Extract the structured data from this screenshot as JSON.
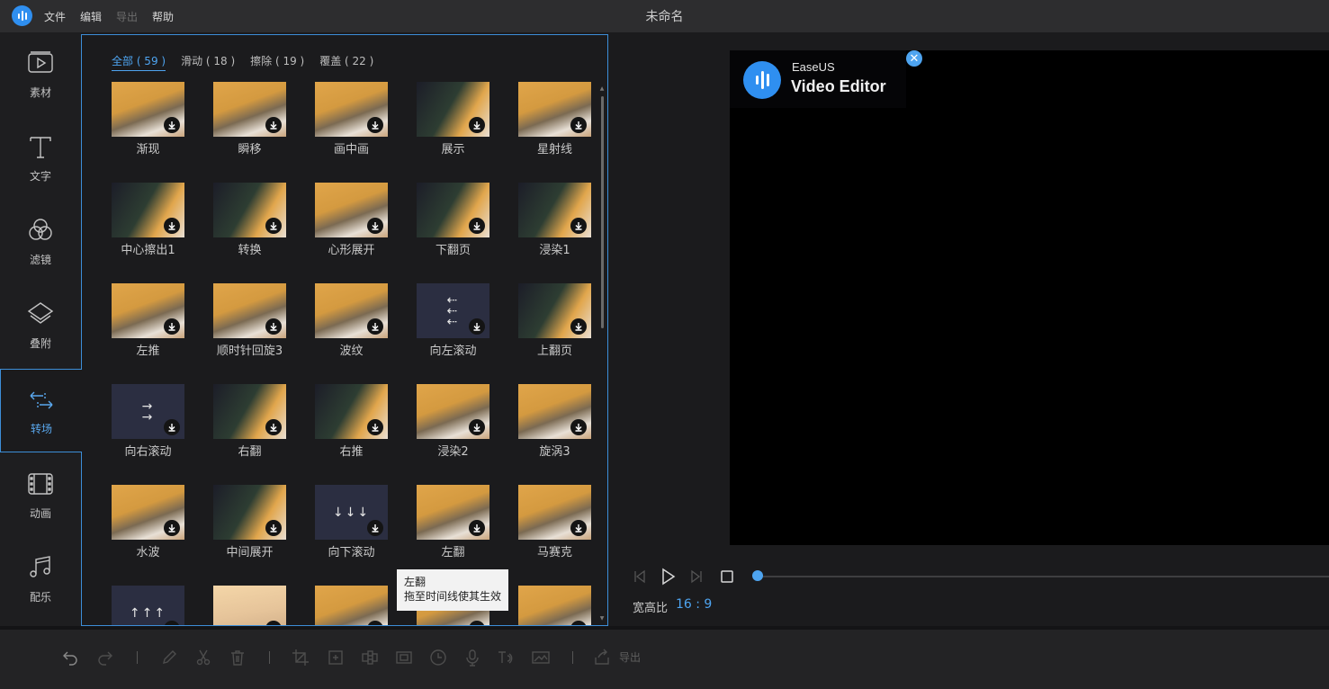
{
  "app": {
    "window_title": "未命名",
    "menu": [
      {
        "label": "文件",
        "disabled": false
      },
      {
        "label": "编辑",
        "disabled": false
      },
      {
        "label": "导出",
        "disabled": true
      },
      {
        "label": "帮助",
        "disabled": false
      }
    ]
  },
  "rail": {
    "items": [
      {
        "label": "素材",
        "icon": "media-icon"
      },
      {
        "label": "文字",
        "icon": "text-icon"
      },
      {
        "label": "滤镜",
        "icon": "filter-icon"
      },
      {
        "label": "叠附",
        "icon": "overlay-icon"
      },
      {
        "label": "转场",
        "icon": "transition-icon",
        "active": true
      },
      {
        "label": "动画",
        "icon": "animation-icon"
      },
      {
        "label": "配乐",
        "icon": "music-icon"
      }
    ]
  },
  "library": {
    "tabs": [
      {
        "label": "全部 ( 59 )",
        "active": true
      },
      {
        "label": "滑动 ( 18 )"
      },
      {
        "label": "擦除 ( 19 )"
      },
      {
        "label": "覆盖 ( 22 )"
      }
    ],
    "transitions": [
      {
        "label": "渐现",
        "style": "cat"
      },
      {
        "label": "瞬移",
        "style": "cat"
      },
      {
        "label": "画中画",
        "style": "cat"
      },
      {
        "label": "展示",
        "style": "dark"
      },
      {
        "label": "星射线",
        "style": "cat"
      },
      {
        "label": "中心擦出1",
        "style": "dark"
      },
      {
        "label": "转换",
        "style": "dark"
      },
      {
        "label": "心形展开",
        "style": "cat"
      },
      {
        "label": "下翻页",
        "style": "dark"
      },
      {
        "label": "浸染1",
        "style": "dark"
      },
      {
        "label": "左推",
        "style": "cat"
      },
      {
        "label": "顺时针回旋3",
        "style": "cat"
      },
      {
        "label": "波纹",
        "style": "cat"
      },
      {
        "label": "向左滚动",
        "style": "plain",
        "glyph": "⇠\n⇠\n⇠"
      },
      {
        "label": "上翻页",
        "style": "dark"
      },
      {
        "label": "向右滚动",
        "style": "plain",
        "glyph": "→\n→"
      },
      {
        "label": "右翻",
        "style": "dark"
      },
      {
        "label": "右推",
        "style": "dark"
      },
      {
        "label": "浸染2",
        "style": "cat"
      },
      {
        "label": "旋涡3",
        "style": "cat"
      },
      {
        "label": "水波",
        "style": "cat"
      },
      {
        "label": "中间展开",
        "style": "dark"
      },
      {
        "label": "向下滚动",
        "style": "plain",
        "glyph": "↓↓↓"
      },
      {
        "label": "左翻",
        "style": "cat"
      },
      {
        "label": "马赛克",
        "style": "cat"
      },
      {
        "label": "",
        "style": "plain",
        "glyph": "↑↑↑"
      },
      {
        "label": "",
        "style": "light"
      },
      {
        "label": "",
        "style": "cat"
      },
      {
        "label": "",
        "style": "cat"
      },
      {
        "label": "",
        "style": "cat"
      }
    ],
    "tooltip": {
      "title": "左翻",
      "hint": "拖至时间线使其生效"
    }
  },
  "preview": {
    "watermark_brand": "EaseUS",
    "watermark_product": "Video Editor",
    "close_glyph": "✕",
    "aspect_label": "宽高比",
    "aspect_value": "16 : 9",
    "playhead_fraction": 0.0
  },
  "toolbar": {
    "export_label": "导出"
  },
  "colors": {
    "accent": "#4ea4f0",
    "brand": "#2f8ff0",
    "bg": "#1b1b1d"
  }
}
